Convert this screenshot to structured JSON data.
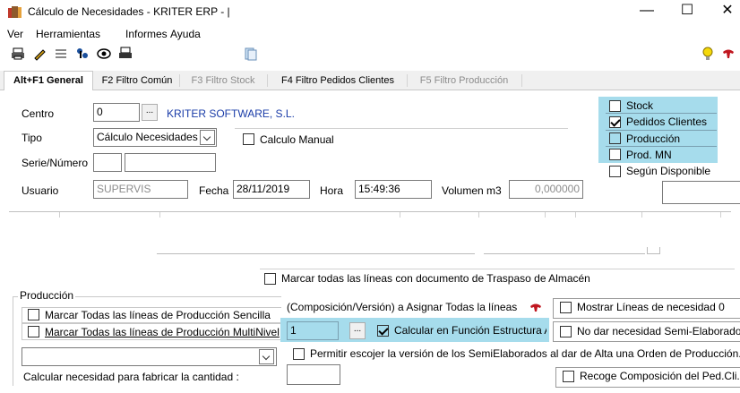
{
  "window": {
    "title": "Cálculo de Necesidades - KRITER ERP - |",
    "minimize": "—",
    "maximize": "☐",
    "close": "✕"
  },
  "menu": [
    "Ver",
    "Herramientas",
    "Informes",
    "Ayuda"
  ],
  "tabs": [
    {
      "label": "Alt+F1 General",
      "state": "active"
    },
    {
      "label": "F2 Filtro Común",
      "state": "normal"
    },
    {
      "label": "F3 Filtro Stock",
      "state": "disabled"
    },
    {
      "label": "F4 Filtro Pedidos Clientes",
      "state": "normal"
    },
    {
      "label": "F5 Filtro Producción",
      "state": "disabled"
    }
  ],
  "general": {
    "centro_label": "Centro",
    "centro_value": "0",
    "centro_btn": "...",
    "centro_name": "KRITER SOFTWARE, S.L.",
    "tipo_label": "Tipo",
    "tipo_value": "Cálculo Necesidades",
    "calculo_manual": "Calculo Manual",
    "serie_label": "Serie/Número",
    "usuario_label": "Usuario",
    "usuario_value": "SUPERVIS",
    "fecha_label": "Fecha",
    "fecha_value": "28/11/2019",
    "hora_label": "Hora",
    "hora_value": "15:49:36",
    "volumen_label": "Volumen m3",
    "volumen_value": "0,000000"
  },
  "filters": [
    {
      "label": "Stock",
      "checked": false
    },
    {
      "label": "Pedidos Clientes",
      "checked": true
    },
    {
      "label": "Producción",
      "checked": false
    },
    {
      "label": "Prod. MN",
      "checked": false
    },
    {
      "label": "Según Disponible",
      "checked": false
    }
  ],
  "bottom": {
    "marcar_traspaso": "Marcar todas las líneas con documento de Traspaso de Almacén",
    "produccion_group": "Producción",
    "marcar_sencilla": "Marcar Todas las líneas de Producción Sencilla",
    "marcar_multinivel": "Marcar Todas las líneas de Producción MultiNivel",
    "composicion_label": "(Composición/Versión) a Asignar Todas la líneas",
    "composicion_value": "1",
    "composicion_btn": "...",
    "calcular_estructura": "Calcular en Función Estructura Ar",
    "mostrar_lineas": "Mostrar Líneas de necesidad 0",
    "no_dar_necesidad": "No dar necesidad Semi-Elaborado",
    "permitir_version": "Permitir escojer la versión de los SemiElaborados al dar de Alta una Orden de Producción.",
    "calcular_cantidad": "Calcular necesidad para fabricar la cantidad :",
    "recoge_composicion": "Recoge Composición del Ped.Cli."
  }
}
